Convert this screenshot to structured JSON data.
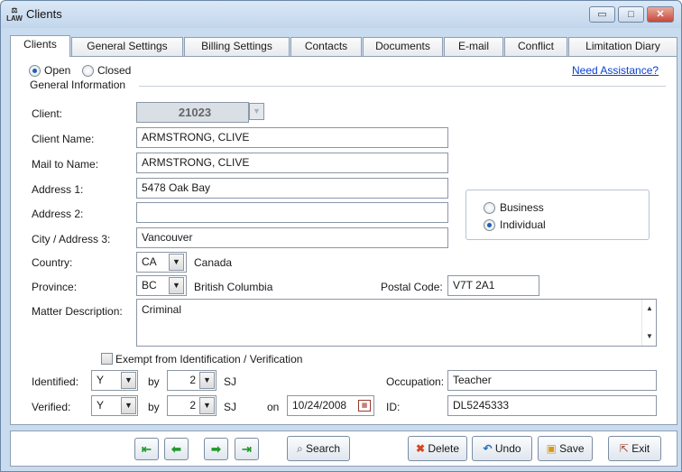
{
  "window": {
    "title": "Clients",
    "app_icon_text": "LAW",
    "controls": {
      "minimize": "▭",
      "maximize": "□",
      "close": "✕"
    }
  },
  "tabs": [
    "Clients",
    "General Settings",
    "Billing Settings",
    "Contacts",
    "Documents",
    "E-mail",
    "Conflict",
    "Limitation Diary"
  ],
  "status": {
    "open_label": "Open",
    "closed_label": "Closed",
    "selected": "Open"
  },
  "assistance_link": "Need Assistance?",
  "group_title": "General Information",
  "client": {
    "label": "Client:",
    "value": "21023"
  },
  "fields": {
    "client_name": {
      "label": "Client Name:",
      "value": "ARMSTRONG, CLIVE"
    },
    "mail_to": {
      "label": "Mail to Name:",
      "value": "ARMSTRONG, CLIVE"
    },
    "address1": {
      "label": "Address 1:",
      "value": "5478 Oak Bay"
    },
    "address2": {
      "label": "Address 2:",
      "value": ""
    },
    "city": {
      "label": "City / Address 3:",
      "value": "Vancouver"
    }
  },
  "entity_type": {
    "business": "Business",
    "individual": "Individual",
    "selected": "Individual"
  },
  "country": {
    "label": "Country:",
    "code": "CA",
    "name": "Canada"
  },
  "province": {
    "label": "Province:",
    "code": "BC",
    "name": "British Columbia"
  },
  "postal": {
    "label": "Postal Code:",
    "value": "V7T 2A1"
  },
  "matter": {
    "label": "Matter Description:",
    "value": "Criminal"
  },
  "exempt": {
    "label": "Exempt from Identification / Verification",
    "checked": false
  },
  "identified": {
    "label": "Identified:",
    "value": "Y",
    "by_label": "by",
    "by_value": "2",
    "initials": "SJ"
  },
  "verified": {
    "label": "Verified:",
    "value": "Y",
    "by_label": "by",
    "by_value": "2",
    "initials": "SJ",
    "on_label": "on",
    "date": "10/24/2008"
  },
  "occupation": {
    "label": "Occupation:",
    "value": "Teacher"
  },
  "id": {
    "label": "ID:",
    "value": "DL5245333"
  },
  "footer": {
    "nav": [
      "first-record",
      "previous-record",
      "next-record",
      "last-record"
    ],
    "search": "Search",
    "delete": "Delete",
    "undo": "Undo",
    "save": "Save",
    "exit": "Exit"
  }
}
